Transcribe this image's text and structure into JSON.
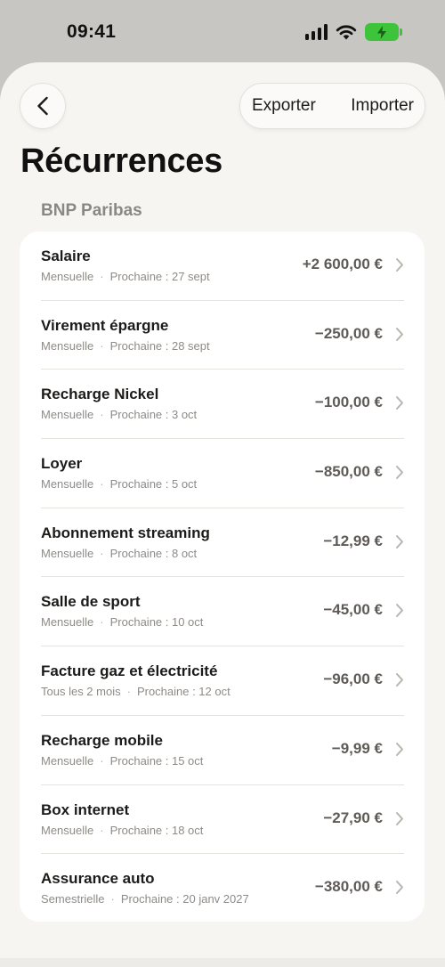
{
  "status": {
    "time": "09:41",
    "icons": [
      "signal-icon",
      "wifi-icon",
      "battery-charging-icon"
    ]
  },
  "header": {
    "back_icon": "chevron-left-icon",
    "export_label": "Exporter",
    "import_label": "Importer"
  },
  "page": {
    "title": "Récurrences",
    "section_title": "BNP Paribas"
  },
  "colors": {
    "battery": "#3ec43a",
    "background": "#f7f5f1",
    "card": "#ffffff"
  },
  "recurrences": [
    {
      "name": "Salaire",
      "frequency": "Mensuelle",
      "next": "Prochaine : 27 sept",
      "amount": "+2 600,00 €"
    },
    {
      "name": "Virement épargne",
      "frequency": "Mensuelle",
      "next": "Prochaine : 28 sept",
      "amount": "−250,00 €"
    },
    {
      "name": "Recharge Nickel",
      "frequency": "Mensuelle",
      "next": "Prochaine : 3 oct",
      "amount": "−100,00 €"
    },
    {
      "name": "Loyer",
      "frequency": "Mensuelle",
      "next": "Prochaine : 5 oct",
      "amount": "−850,00 €"
    },
    {
      "name": "Abonnement streaming",
      "frequency": "Mensuelle",
      "next": "Prochaine : 8 oct",
      "amount": "−12,99 €"
    },
    {
      "name": "Salle de sport",
      "frequency": "Mensuelle",
      "next": "Prochaine : 10 oct",
      "amount": "−45,00 €"
    },
    {
      "name": "Facture gaz et électricité",
      "frequency": "Tous les 2 mois",
      "next": "Prochaine : 12 oct",
      "amount": "−96,00 €"
    },
    {
      "name": "Recharge mobile",
      "frequency": "Mensuelle",
      "next": "Prochaine : 15 oct",
      "amount": "−9,99 €"
    },
    {
      "name": "Box internet",
      "frequency": "Mensuelle",
      "next": "Prochaine : 18 oct",
      "amount": "−27,90 €"
    },
    {
      "name": "Assurance auto",
      "frequency": "Semestrielle",
      "next": "Prochaine : 20 janv 2027",
      "amount": "−380,00 €"
    }
  ]
}
